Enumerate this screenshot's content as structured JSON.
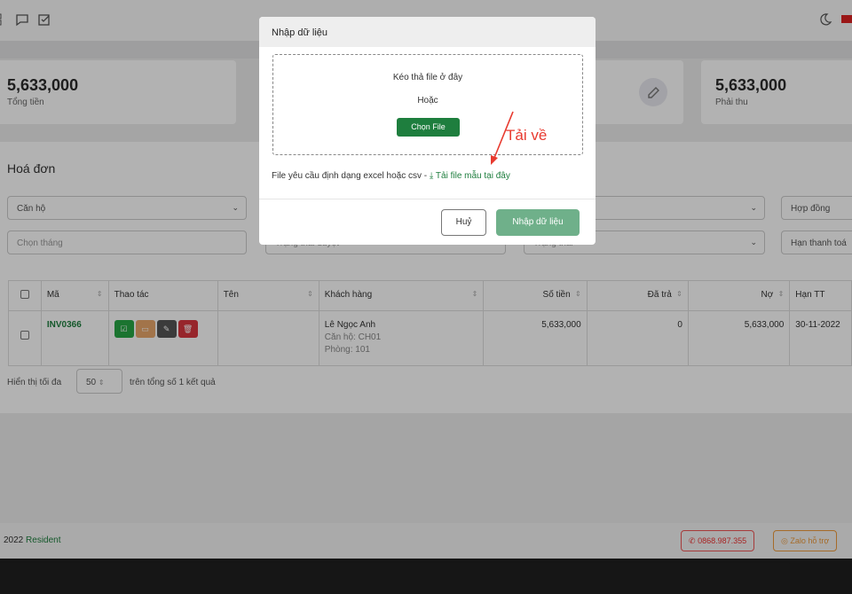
{
  "stats": [
    {
      "value": "5,633,000",
      "label": "Tổng tiền"
    },
    {
      "value": "5,633,000",
      "label": "Phải thu"
    }
  ],
  "panel": {
    "title": "Hoá đơn",
    "filters": {
      "apartment": "Căn hộ",
      "month": "Chọn tháng",
      "approval_status": "Trạng thái duyệt",
      "status": "Trạng thái",
      "contract": "Hợp đồng",
      "due_date": "Hạn thanh toá"
    }
  },
  "table": {
    "headers": [
      "Mã",
      "Thao tác",
      "Tên",
      "Khách hàng",
      "Số tiền",
      "Đã trả",
      "Nợ",
      "Hạn TT"
    ],
    "rows": [
      {
        "code": "INV0366",
        "name": "",
        "customer": "Lê Ngọc Anh",
        "apartment": "Căn hộ: CH01",
        "room": "Phòng: 101",
        "amount": "5,633,000",
        "paid": "0",
        "debt": "5,633,000",
        "due": "30-11-2022"
      }
    ]
  },
  "pager": {
    "prefix": "Hiển thị tối đa",
    "page_size": "50",
    "suffix": "trên tổng số 1 kết quả"
  },
  "footer": {
    "year": "2022",
    "brand": "Resident",
    "phone": "0868.987.355",
    "zalo": "Zalo hỗ trợ"
  },
  "modal": {
    "title": "Nhập dữ liệu",
    "drag_text": "Kéo thả file ở đây",
    "or_text": "Hoặc",
    "choose_file": "Chọn File",
    "requirement": "File yêu cầu định dạng excel hoặc csv -",
    "download_link": "Tải file mẫu tại đây",
    "cancel": "Huỷ",
    "submit": "Nhập dữ liệu"
  },
  "annotation": "Tải về",
  "colors": {
    "brand_green": "#1e7e3e",
    "annotation_red": "#e83a2f",
    "submit_green": "#6fb08a"
  }
}
